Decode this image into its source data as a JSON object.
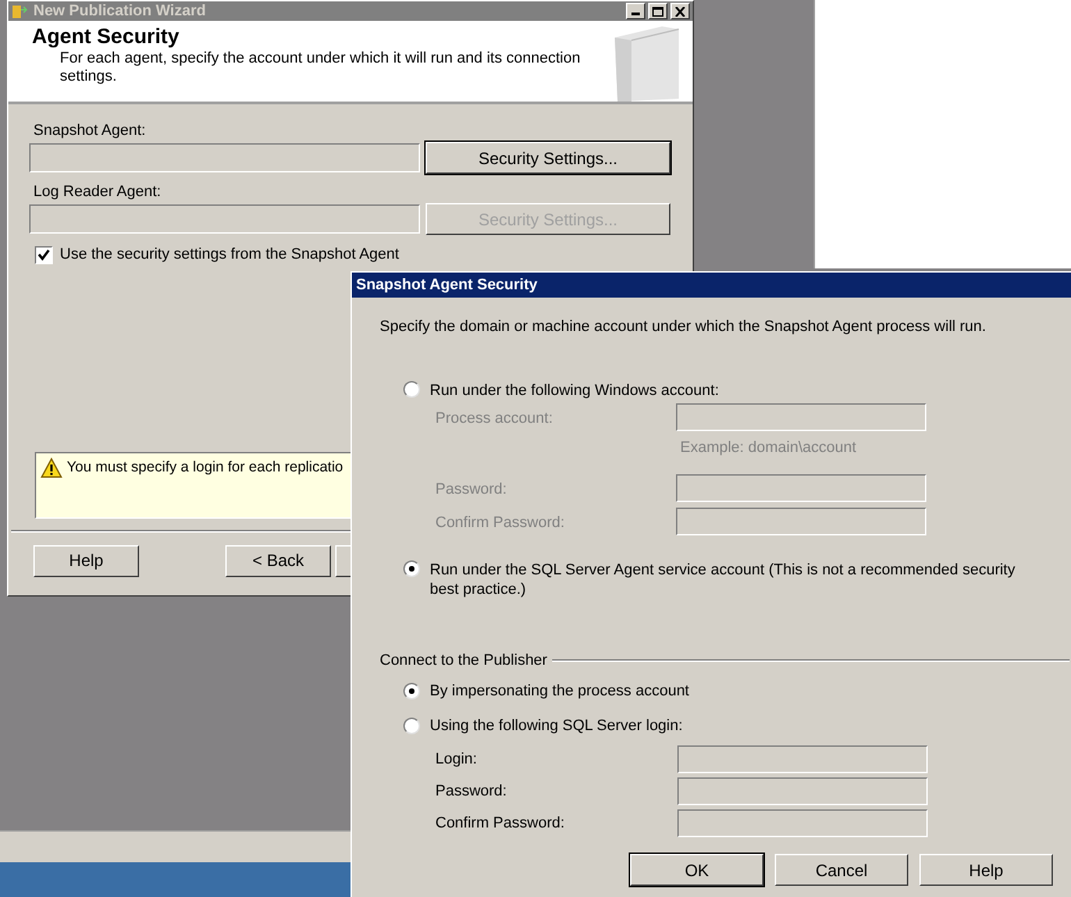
{
  "wizard": {
    "title": "New Publication Wizard",
    "header": {
      "title": "Agent Security",
      "description": "For each agent, specify the account under which it will run and its connection settings."
    },
    "agents": [
      {
        "label": "Snapshot Agent:",
        "button": "Security Settings...",
        "disabled": false,
        "default": true
      },
      {
        "label": "Log Reader Agent:",
        "button": "Security Settings...",
        "disabled": true,
        "default": false
      }
    ],
    "use_snapshot_settings": {
      "label": "Use the security settings from the Snapshot Agent",
      "checked": true
    },
    "warning": "You must specify a login for each replicatio",
    "buttons": [
      "Help",
      "< Back"
    ]
  },
  "dialog": {
    "title": "Snapshot Agent Security",
    "instruction": "Specify the domain or machine account under which the Snapshot Agent process will run.",
    "account_options": [
      {
        "label": "Run under the following Windows account:",
        "selected": false,
        "fields": [
          {
            "label": "Process account:",
            "disabled": true,
            "hint": "Example: domain\\account"
          },
          {
            "label": "Password:",
            "disabled": true
          },
          {
            "label": "Confirm Password:",
            "disabled": true
          }
        ]
      },
      {
        "label": "Run under the SQL Server Agent service account (This is not a recommended security best practice.)",
        "selected": true
      }
    ],
    "publisher": {
      "title": "Connect to the Publisher",
      "options": [
        {
          "label": "By impersonating the process account",
          "selected": true
        },
        {
          "label": "Using the following SQL Server login:",
          "selected": false
        }
      ],
      "fields": [
        {
          "label": "Login:",
          "disabled": false
        },
        {
          "label": "Password:",
          "disabled": false
        },
        {
          "label": "Confirm Password:",
          "disabled": false
        }
      ]
    },
    "buttons": [
      {
        "label": "OK",
        "default": true
      },
      {
        "label": "Cancel",
        "default": false
      },
      {
        "label": "Help",
        "default": false
      }
    ]
  }
}
